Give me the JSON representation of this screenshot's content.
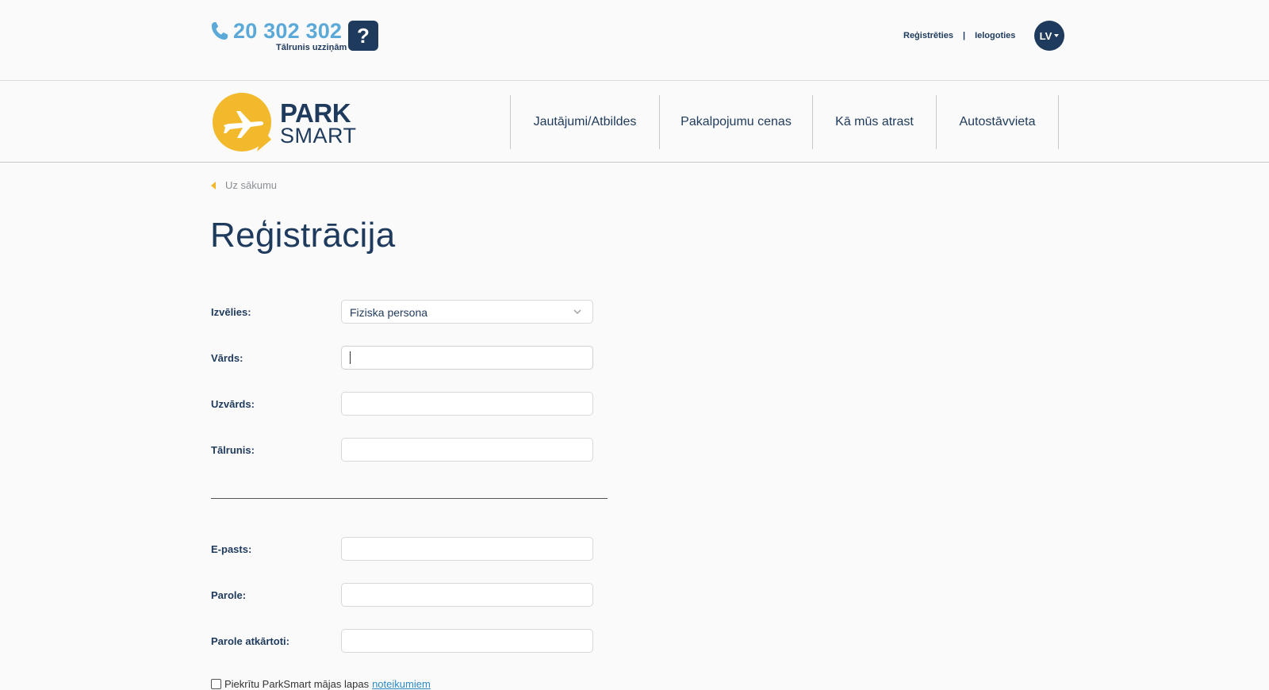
{
  "header": {
    "phone_number": "20 302 302",
    "phone_subtitle": "Tālrunis uzziņām",
    "help_label": "?",
    "register_link": "Reģistrēties",
    "separator": "|",
    "login_link": "Ielogoties",
    "language": "LV"
  },
  "brand": {
    "name_top": "PARK",
    "name_bottom": "SMART",
    "colors": {
      "navy": "#1e3a5c",
      "yellow": "#f3b92c",
      "blue": "#5aa9d8"
    }
  },
  "nav": {
    "items": [
      {
        "label": "Jautājumi/Atbildes"
      },
      {
        "label": "Pakalpojumu cenas"
      },
      {
        "label": "Kā mūs atrast"
      },
      {
        "label": "Autostāvvieta"
      }
    ]
  },
  "breadcrumb": {
    "back_label": "Uz sākumu"
  },
  "page": {
    "title": "Reģistrācija"
  },
  "form": {
    "type_label": "Izvēlies:",
    "type_value": "Fiziska persona",
    "first_name_label": "Vārds:",
    "first_name_value": "",
    "last_name_label": "Uzvārds:",
    "last_name_value": "",
    "phone_label": "Tālrunis:",
    "phone_value": "",
    "email_label": "E-pasts:",
    "email_value": "",
    "password_label": "Parole:",
    "password_value": "",
    "password_repeat_label": "Parole atkārtoti:",
    "password_repeat_value": "",
    "terms_text": "Piekrītu ParkSmart mājas lapas",
    "terms_link": "noteikumiem"
  }
}
